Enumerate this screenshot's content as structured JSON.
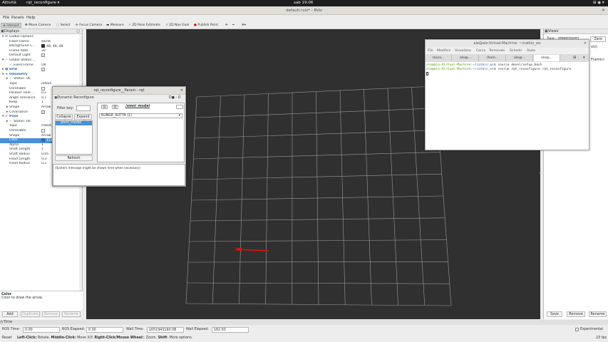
{
  "topbar": {
    "activities": "Attività",
    "app": "rqt_reconfigure ▾",
    "clock": "sab 19:06",
    "tray": "⊞ ◉ ▾"
  },
  "rviz": {
    "title": "default.rviz* - RViz"
  },
  "menu": [
    "File",
    "Panels",
    "Help"
  ],
  "toolbar": [
    "Interact",
    "Move Camera",
    "Select",
    "Focus Camera",
    "Measure",
    "2D Pose Estimate",
    "2D Nav Goal",
    "Publish Point"
  ],
  "displays": {
    "title": "Displays",
    "rows": [
      {
        "k": "Global Options",
        "v": "",
        "d": 1,
        "arrow": "▾",
        "icon": "gear"
      },
      {
        "k": "Fixed Frame",
        "v": "world",
        "d": 2
      },
      {
        "k": "Background C...",
        "v": "48; 48; 48",
        "d": 2
      },
      {
        "k": "Frame Rate",
        "v": "30",
        "d": 2
      },
      {
        "k": "Default Light",
        "v": "✓",
        "d": 2
      },
      {
        "k": "Global Status:...",
        "v": "",
        "d": 1,
        "arrow": "▾",
        "icon": "check"
      },
      {
        "k": "Fixed Frame",
        "v": "OK",
        "d": 2,
        "icon": "check"
      },
      {
        "k": "Grid",
        "v": "✓",
        "d": 1,
        "arrow": "▸",
        "icon": "grid",
        "blue": true
      },
      {
        "k": "Odometry",
        "v": "",
        "d": 1,
        "arrow": "▾",
        "icon": "odom",
        "blue": true
      },
      {
        "k": "Status: Ok",
        "v": "",
        "d": 2,
        "arrow": "▸",
        "icon": "check"
      },
      {
        "k": "Topic",
        "v": "/odom",
        "d": 2
      },
      {
        "k": "Unreliable",
        "v": "",
        "d": 2
      },
      {
        "k": "Position Toler...",
        "v": "0,1",
        "d": 2
      },
      {
        "k": "Angle Tolerance",
        "v": "0,1",
        "d": 2
      },
      {
        "k": "Keep",
        "v": "1",
        "d": 2
      },
      {
        "k": "Shape",
        "v": "Arrow",
        "d": 2,
        "arrow": "▸"
      },
      {
        "k": "Covariance",
        "v": "✓",
        "d": 2,
        "arrow": "▸"
      },
      {
        "k": "Pose",
        "v": "",
        "d": 1,
        "arrow": "▾",
        "icon": "pose",
        "blue": true
      },
      {
        "k": "Status: Ok",
        "v": "",
        "d": 2,
        "arrow": "▸",
        "icon": "check"
      },
      {
        "k": "Topic",
        "v": "/robot_",
        "d": 2
      },
      {
        "k": "Unreliable",
        "v": "",
        "d": 2
      },
      {
        "k": "Shape",
        "v": "Arrow",
        "d": 2
      },
      {
        "k": "Color",
        "v": "114",
        "d": 2,
        "sel": true
      },
      {
        "k": "Alpha",
        "v": "1",
        "d": 2
      },
      {
        "k": "Shaft Length",
        "v": "1",
        "d": 2
      },
      {
        "k": "Shaft Radius",
        "v": "0,05",
        "d": 2
      },
      {
        "k": "Head Length",
        "v": "0,3",
        "d": 2
      },
      {
        "k": "Head Radius",
        "v": "0,1",
        "d": 2
      }
    ]
  },
  "description": {
    "title": "Color",
    "text": "Color to draw the arrow."
  },
  "left_buttons": {
    "add": "Add",
    "duplicate": "Duplicate",
    "remove": "Remove",
    "rename": "Rename"
  },
  "views": {
    "title": "Views",
    "type_label": "Type:",
    "type_value": "Orbit (rviz)",
    "zero": "Zero",
    "frame_text": "Frame>",
    "viz_text": "viz)"
  },
  "right_buttons": {
    "save": "Save",
    "remove": "Remove",
    "rename": "Rename"
  },
  "time": {
    "title": "Time",
    "ros_time_label": "ROS Time:",
    "ros_time": "0.00",
    "ros_elapsed_label": "ROS Elapsed:",
    "ros_elapsed": "0.00",
    "wall_time_label": "Wall Time:",
    "wall_time": "1651943190.08",
    "wall_elapsed_label": "Wall Elapsed:",
    "wall_elapsed": "182.93",
    "experimental": "Experimental"
  },
  "status": {
    "reset": "Reset",
    "hint_bold1": "Left-Click:",
    "hint1": " Rotate. ",
    "hint_bold2": "Middle-Click:",
    "hint2": " Move X/Y. ",
    "hint_bold3": "Right-Click/Mouse Wheel:",
    "hint3": ": Zoom. ",
    "hint_bold4": "Shift",
    "hint4": ": More options.",
    "fps": "23 fps"
  },
  "terminal": {
    "title": "ale@ale-Virtual-Machine: ~/catkin_ws",
    "menu": [
      "File",
      "Modifica",
      "Visualizza",
      "Cerca",
      "Terminale",
      "Schede",
      "Aiuto"
    ],
    "tabs": [
      "rosco...",
      "ale@...",
      "/hom...",
      "ale@...",
      "ale@..."
    ],
    "prompt_user": "ale@ale-Virtual-Machine",
    "prompt_path": ":~/catkin_ws",
    "cmd1": "$ source devel/setup.bash",
    "cmd2": "$ rosrun rqt_reconfigure rqt_reconfigure"
  },
  "rqt": {
    "title": "rqt_reconfigure__Param - rqt",
    "plugin": "Dynamic Reconfigure",
    "plugin_ctrls": "D● - O",
    "filter_label": "Filter key:",
    "collapse": "Collapse al",
    "expand": "Expand al",
    "node_item": "omni_model",
    "refresh": "Refresh",
    "node_path": "/omni_model",
    "param_value": "RUNGE_KUTTA (1)",
    "message": "(System message might be shown here when necessary)"
  }
}
